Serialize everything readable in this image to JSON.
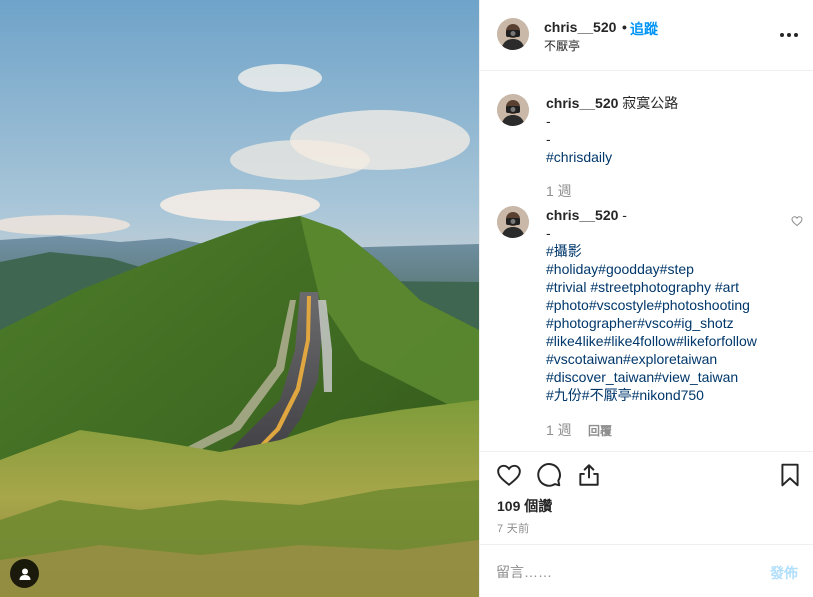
{
  "post": {
    "photo_icon": "mountain-road-photo",
    "user_tag_icon": "person-icon"
  },
  "header": {
    "username": "chris__520",
    "separator": "•",
    "follow_label": "追蹤",
    "location": "不厭亭",
    "more_icon": "more-options-icon"
  },
  "caption": {
    "username": "chris__520",
    "lines": [
      "寂寞公路",
      "-",
      "-",
      "#chrisdaily"
    ],
    "age": "1 週"
  },
  "comment": {
    "username": "chris__520",
    "first_line": "-",
    "lines": [
      "-",
      "#攝影",
      "#holiday#goodday#step",
      "#trivial #streetphotography #art",
      "#photo#vscostyle#photoshooting",
      "#photographer#vsco#ig_shotz",
      "#like4like#like4follow#likeforfollow",
      "#vscotaiwan#exploretaiwan",
      "#discover_taiwan#view_taiwan",
      "#九份#不厭亭#nikond750"
    ],
    "age": "1 週",
    "reply_label": "回覆"
  },
  "actions": {
    "like_icon": "heart-icon",
    "comment_icon": "comment-icon",
    "share_icon": "share-icon",
    "save_icon": "bookmark-icon",
    "likes_text": "109 個讚",
    "time_text": "7 天前"
  },
  "comment_box": {
    "placeholder": "留言……",
    "post_label": "發佈"
  },
  "colors": {
    "link_blue": "#0095f6",
    "hashtag": "#00376b",
    "muted": "#8e8e8e",
    "post_disabled": "#b2dffc"
  }
}
